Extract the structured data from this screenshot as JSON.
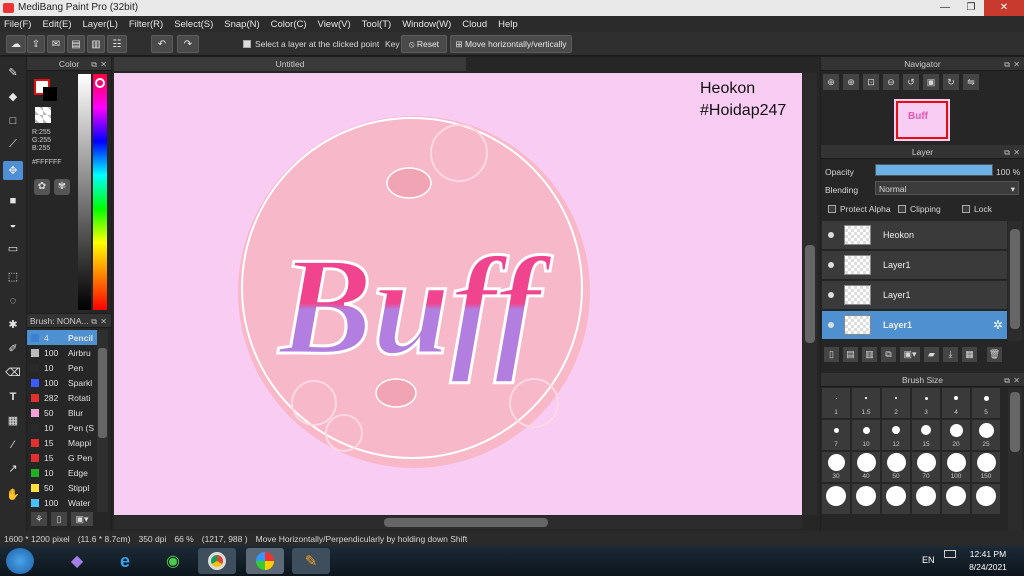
{
  "window": {
    "title": "MediBang Paint Pro (32bit)",
    "minimize": "—",
    "restore": "❐",
    "close": "✕"
  },
  "menu": [
    "File(F)",
    "Edit(E)",
    "Layer(L)",
    "Filter(R)",
    "Select(S)",
    "Snap(N)",
    "Color(C)",
    "View(V)",
    "Tool(T)",
    "Window(W)",
    "Cloud",
    "Help"
  ],
  "toolbar": {
    "select_layer_label": "Select a layer at the clicked point",
    "key_label": "Key",
    "reset_label": "Reset",
    "move_label": "Move horizontally/vertically"
  },
  "color_panel": {
    "title": "Color",
    "r": "R:255",
    "g": "G:255",
    "b": "B:255",
    "hex": "#FFFFFF"
  },
  "brush_panel": {
    "title": "Brush: NONA...",
    "items": [
      {
        "size": "4",
        "name": "Pencil",
        "color": "#3d7fd0"
      },
      {
        "size": "100",
        "name": "Airbru",
        "color": "#bbbbbb"
      },
      {
        "size": "10",
        "name": "Pen",
        "color": "#2a2a2a"
      },
      {
        "size": "100",
        "name": "Sparkl",
        "color": "#3a5cff"
      },
      {
        "size": "282",
        "name": "Rotati",
        "color": "#e03030"
      },
      {
        "size": "50",
        "name": "Blur",
        "color": "#f2a0d8"
      },
      {
        "size": "10",
        "name": "Pen (S",
        "color": "#2a2a2a"
      },
      {
        "size": "15",
        "name": "Mappi",
        "color": "#e03030"
      },
      {
        "size": "15",
        "name": "G Pen",
        "color": "#e03030"
      },
      {
        "size": "10",
        "name": "Edge",
        "color": "#20b020"
      },
      {
        "size": "50",
        "name": "Stippl",
        "color": "#ffe040"
      },
      {
        "size": "100",
        "name": "Water",
        "color": "#48c0ff"
      }
    ]
  },
  "document": {
    "tab_title": "Untitled",
    "watermark_line1": "Heokon",
    "watermark_line2": "#Hoidap247",
    "art_text": "Buff"
  },
  "navigator": {
    "title": "Navigator"
  },
  "layer_panel": {
    "title": "Layer",
    "opacity_label": "Opacity",
    "opacity_value": "100",
    "opacity_unit": "%",
    "opacity_fraction": 1.0,
    "blending_label": "Blending",
    "blending_value": "Normal",
    "protect_alpha": "Protect Alpha",
    "clipping": "Clipping",
    "lock": "Lock",
    "layers": [
      {
        "name": "Heokon",
        "selected": false
      },
      {
        "name": "Layer1",
        "selected": false
      },
      {
        "name": "Layer1",
        "selected": false
      },
      {
        "name": "Layer1",
        "selected": true
      }
    ]
  },
  "brush_size": {
    "title": "Brush Size",
    "sizes": [
      "1",
      "1.5",
      "2",
      "3",
      "4",
      "5",
      "7",
      "10",
      "12",
      "15",
      "20",
      "25",
      "30",
      "40",
      "50",
      "70",
      "100",
      "150"
    ]
  },
  "status": {
    "dimensions": "1600 * 1200 pixel",
    "physical": "(11.6 * 8.7cm)",
    "dpi": "350 dpi",
    "zoom": "66 %",
    "cursor": "(1217, 988 )",
    "hint": "Move Horizontally/Perpendicularly by holding down Shift"
  },
  "taskbar": {
    "lang": "EN",
    "time": "12:41 PM",
    "date": "8/24/2021"
  },
  "colors": {
    "canvas_bg": "#f9ccf3",
    "circle": "#f8b8c8",
    "accent": "#4e90d0",
    "pink": "#f0458e",
    "purple": "#b27fe0"
  }
}
